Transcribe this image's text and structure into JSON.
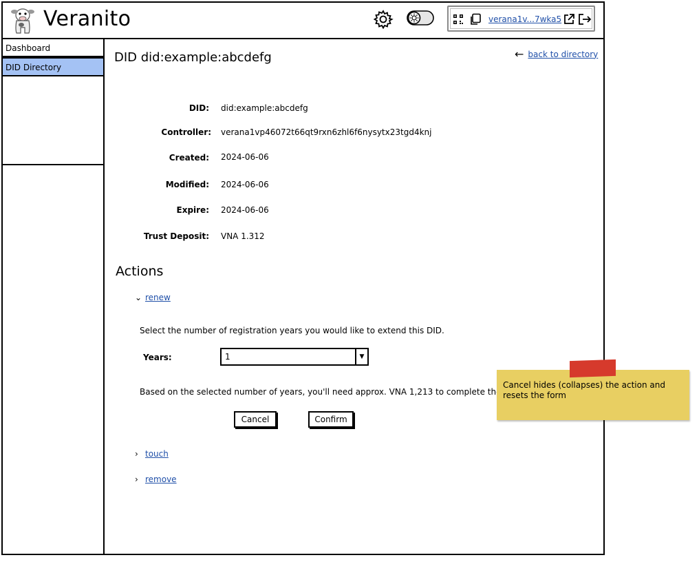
{
  "header": {
    "app_title": "Veranito",
    "wallet_address": "verana1v...7wka5"
  },
  "sidebar": {
    "items": [
      {
        "label": "Dashboard"
      },
      {
        "label": "DID Directory"
      }
    ]
  },
  "main": {
    "title": "DID did:example:abcdefg",
    "back_link": "back to directory",
    "fields": [
      {
        "label": "DID:",
        "value": "did:example:abcdefg"
      },
      {
        "label": "Controller:",
        "value": "verana1vp46072t66qt9rxn6zhl6f6nysytx23tgd4knj"
      },
      {
        "label": "Created:",
        "value": "2024-06-06"
      },
      {
        "label": "Modified:",
        "value": "2024-06-06"
      },
      {
        "label": "Expire:",
        "value": "2024-06-06"
      },
      {
        "label": "Trust Deposit:",
        "value": "VNA 1.312"
      }
    ],
    "actions_title": "Actions",
    "actions": [
      {
        "label": "renew",
        "expanded": true
      },
      {
        "label": "touch",
        "expanded": false
      },
      {
        "label": "remove",
        "expanded": false
      }
    ],
    "renew_form": {
      "instruction": "Select the number of registration years you would like to extend this DID.",
      "years_label": "Years:",
      "years_value": "1",
      "cost_note": "Based on the selected number of years, you'll need approx. VNA 1,213 to complete the tra",
      "cancel_label": "Cancel",
      "confirm_label": "Confirm"
    }
  },
  "annotation": {
    "note": "Cancel hides (collapses) the action and resets the form"
  },
  "colors": {
    "nav_active": "#a4c2f4",
    "link": "#1f4fa8",
    "sticky": "#e8cf62",
    "sticky_tape": "#d63a2c"
  }
}
